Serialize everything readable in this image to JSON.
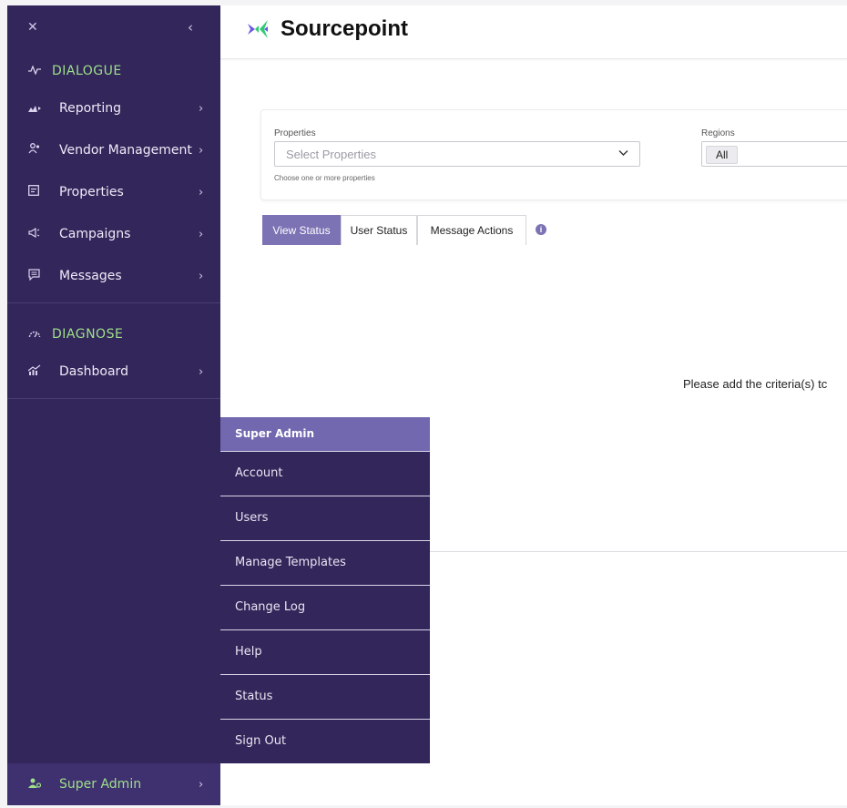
{
  "sidebar": {
    "sections": [
      {
        "heading": "DIALOGUE",
        "icon": "pulse-icon",
        "items": [
          {
            "label": "Reporting",
            "icon": "chart-icon"
          },
          {
            "label": "Vendor Management",
            "icon": "users-icon"
          },
          {
            "label": "Properties",
            "icon": "document-icon"
          },
          {
            "label": "Campaigns",
            "icon": "megaphone-icon"
          },
          {
            "label": "Messages",
            "icon": "message-icon"
          }
        ]
      },
      {
        "heading": "DIAGNOSE",
        "icon": "gauge-icon",
        "items": [
          {
            "label": "Dashboard",
            "icon": "trend-icon"
          }
        ]
      }
    ],
    "footer_label": "Super Admin"
  },
  "header": {
    "brand": "Sourcepoint"
  },
  "filters": {
    "properties_label": "Properties",
    "properties_placeholder": "Select Properties",
    "properties_hint": "Choose one or more properties",
    "regions_label": "Regions",
    "regions_value": "All"
  },
  "tabs": [
    {
      "label": "View Status",
      "active": true
    },
    {
      "label": "User Status",
      "active": false
    },
    {
      "label": "Message Actions",
      "active": false
    }
  ],
  "empty_message": "Please add the criteria(s) tc",
  "popup": {
    "title": "Super Admin",
    "items": [
      "Account",
      "Users",
      "Manage Templates",
      "Change Log",
      "Help",
      "Status",
      "Sign Out"
    ]
  },
  "colors": {
    "sidebar_bg": "#33265a",
    "accent_green": "#9ee08a",
    "tab_active": "#7c73b4"
  }
}
